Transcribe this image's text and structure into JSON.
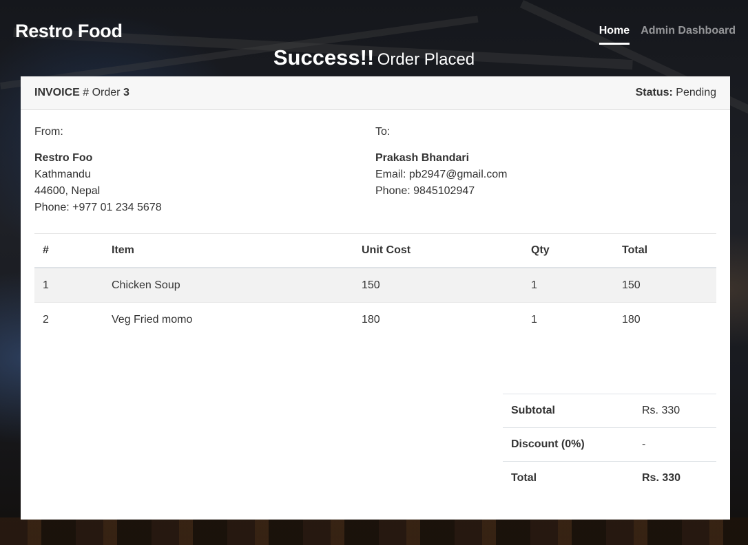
{
  "header": {
    "brand": "Restro Food",
    "nav": [
      {
        "label": "Home",
        "active": true
      },
      {
        "label": "Admin Dashboard",
        "active": false
      }
    ]
  },
  "hero": {
    "title": "Success!!",
    "subtitle": "Order Placed"
  },
  "invoice": {
    "label": "INVOICE",
    "hash": "#",
    "order_word": "Order",
    "order_number": "3",
    "status_label": "Status:",
    "status_value": "Pending"
  },
  "from": {
    "label": "From:",
    "name": "Restro Foo",
    "line1": "Kathmandu",
    "line2": "44600, Nepal",
    "phone": "Phone: +977 01 234 5678"
  },
  "to": {
    "label": "To:",
    "name": "Prakash Bhandari",
    "email": "Email: pb2947@gmail.com",
    "phone": "Phone: 9845102947"
  },
  "items_table": {
    "headers": [
      "#",
      "Item",
      "Unit Cost",
      "Qty",
      "Total"
    ],
    "rows": [
      [
        "1",
        "Chicken Soup",
        "150",
        "1",
        "150"
      ],
      [
        "2",
        "Veg Fried momo",
        "180",
        "1",
        "180"
      ]
    ]
  },
  "totals": {
    "subtotal_label": "Subtotal",
    "subtotal_value": "Rs. 330",
    "discount_label": "Discount (0%)",
    "discount_value": "-",
    "total_label": "Total",
    "total_value": "Rs. 330"
  }
}
